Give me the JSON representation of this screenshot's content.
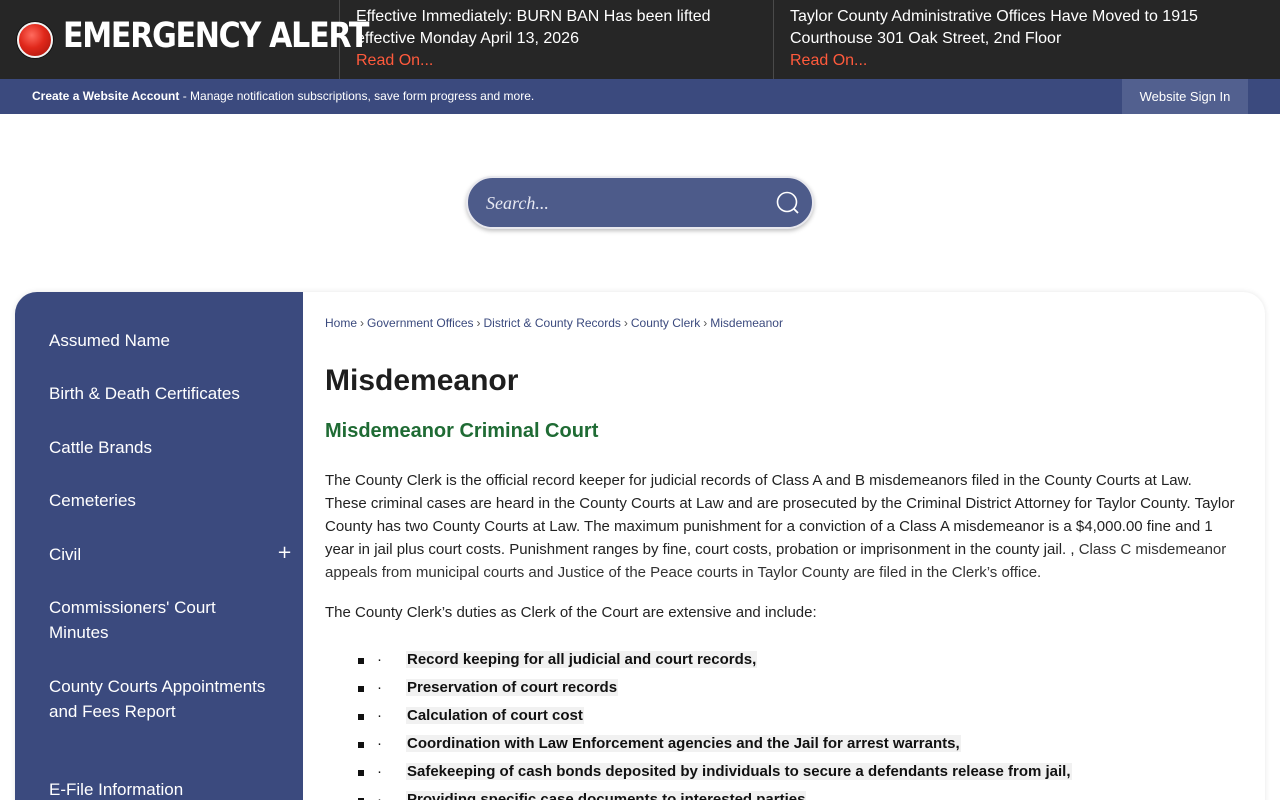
{
  "alert": {
    "title": "EMERGENCY ALERT",
    "items": [
      {
        "text": "Effective Immediately: BURN BAN Has been lifted effective Monday April 13, 2026",
        "link": "Read On..."
      },
      {
        "text": "Taylor County Administrative Offices Have Moved to 1915 Courthouse 301 Oak Street, 2nd Floor",
        "link": "Read On..."
      }
    ]
  },
  "account": {
    "create_link": "Create a Website Account",
    "create_desc": " - Manage notification subscriptions, save form progress and more.",
    "signin": "Website Sign In"
  },
  "search": {
    "placeholder": "Search..."
  },
  "sidebar": {
    "items": [
      {
        "label": "Assumed Name"
      },
      {
        "label": "Birth & Death Certificates"
      },
      {
        "label": "Cattle Brands"
      },
      {
        "label": "Cemeteries"
      },
      {
        "label": "Civil",
        "expand": "+"
      },
      {
        "label": "Commissioners' Court Minutes"
      },
      {
        "label": "County Courts Appointments and Fees Report"
      },
      {
        "label": "E-File Information"
      }
    ]
  },
  "breadcrumb": [
    "Home",
    "Government Offices",
    "District & County Records",
    "County Clerk",
    "Misdemeanor"
  ],
  "breadcrumb_sep": "›",
  "page": {
    "title": "Misdemeanor",
    "subtitle": "Misdemeanor Criminal Court",
    "paragraph_main": " The County Clerk is the official record keeper for judicial records of Class A and B misdemeanors filed in the County Courts at Law. These criminal cases are heard in the County Courts at Law and are prosecuted by the Criminal District Attorney for Taylor County. Taylor County has two County Courts at Law.  The maximum punishment for a conviction of a Class A misdemeanor is a $4,000.00 fine and 1 year in jail plus court costs. Punishment ranges by fine, court costs, probation or imprisonment in the county jail.  , ",
    "paragraph_light": "Class C misdemeanor appeals from municipal courts and Justice of the Peace courts in Taylor County are filed in the Clerk’s office.",
    "duties_intro": "The County Clerk’s duties as Clerk of the Court are extensive and include:",
    "bullet_char": "·",
    "duties": [
      "Record keeping for all judicial and court records,",
      "Preservation of court records",
      "Calculation of court cost",
      "Coordination with Law Enforcement agencies and the Jail for arrest warrants,",
      "Safekeeping of cash bonds deposited by individuals to secure a defendants release from jail,",
      "Providing specific case documents to interested parties"
    ]
  },
  "colors": {
    "alert_bg": "#262626",
    "alert_link": "#ff5a3c",
    "brand_blue": "#3b4a7e",
    "search_bg": "#4d5b8a",
    "subtitle_green": "#1f6b34"
  }
}
